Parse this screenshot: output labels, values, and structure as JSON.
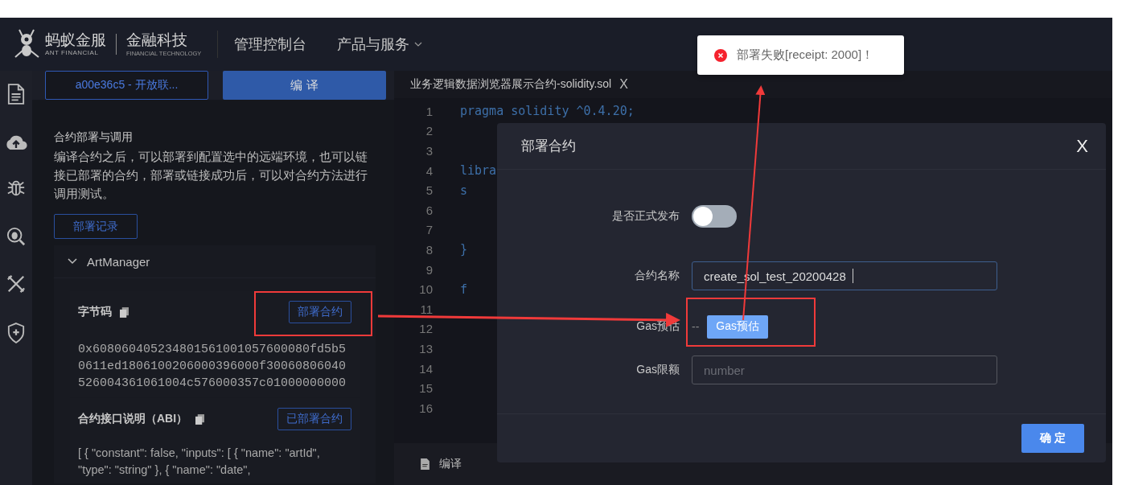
{
  "header": {
    "logo_cn": "蚂蚁金服",
    "logo_en": "ANT FINANCIAL",
    "brand_cn": "金融科技",
    "brand_en": "FINANCIAL TECHNOLOGY",
    "nav": [
      {
        "label": "管理控制台",
        "dropdown": false
      },
      {
        "label": "产品与服务",
        "dropdown": true
      }
    ]
  },
  "panel": {
    "environment": "a00e36c5 - 开放联...",
    "compile_button": "编 译",
    "section_title": "合约部署与调用",
    "description": "编译合约之后，可以部署到配置选中的远端环境，也可以链接已部署的合约，部署或链接成功后，可以对合约方法进行调用测试。",
    "history_button": "部署记录",
    "contract": {
      "name": "ArtManager",
      "expanded": true,
      "sections": [
        {
          "title": "字节码",
          "button": "部署合约",
          "content": "0x608060405234801561001057600080fd5b50611ed1806100206000396000f30060806040526004361061004c576000357c01000000000"
        },
        {
          "title": "合约接口说明（ABI）",
          "button": "已部署合约",
          "content": "[ { \"constant\": false, \"inputs\": [ { \"name\": \"artId\", \"type\": \"string\" }, { \"name\": \"date\","
        }
      ]
    }
  },
  "editor": {
    "tab": {
      "title": "业务逻辑数据浏览器展示合约-solidity.sol",
      "close": "X"
    },
    "lines": [
      {
        "number": "1",
        "code": "pragma solidity ^0.4.20;"
      },
      {
        "number": "2"
      },
      {
        "number": "3"
      },
      {
        "number": "4",
        "code": "libra"
      },
      {
        "number": "5",
        "code": "s"
      },
      {
        "number": "6"
      },
      {
        "number": "7"
      },
      {
        "number": "8",
        "code": "}"
      },
      {
        "number": "9"
      },
      {
        "number": "10",
        "code": "f"
      },
      {
        "number": "11"
      },
      {
        "number": "12"
      },
      {
        "number": "13"
      },
      {
        "number": "14"
      },
      {
        "number": "15"
      },
      {
        "number": "16"
      }
    ],
    "bottom_tab": "编译"
  },
  "dialog": {
    "title": "部署合约",
    "close": "X",
    "publish_label": "是否正式发布",
    "publish_on": false,
    "name_label": "合约名称",
    "name_value": "create_sol_test_20200428",
    "gas_estimate_label": "Gas预估",
    "gas_estimate_value": "--",
    "gas_estimate_button": "Gas预估",
    "gas_limit_label": "Gas限额",
    "gas_limit_placeholder": "number",
    "confirm_button": "确 定"
  },
  "toast": {
    "message": "部署失败[receipt: 2000]！"
  }
}
